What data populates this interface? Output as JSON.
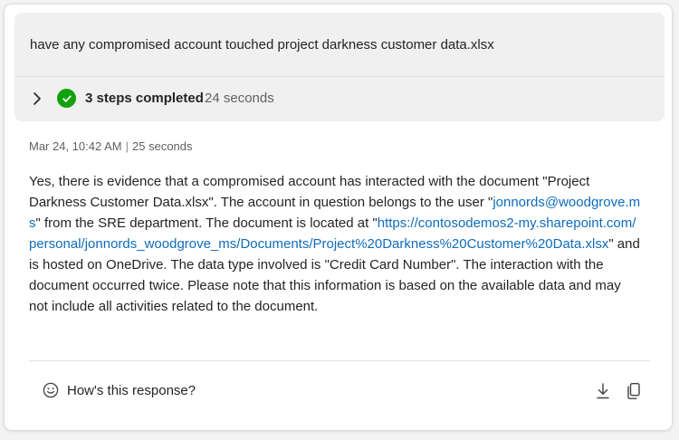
{
  "prompt": {
    "text": "have any compromised account touched project darkness customer data.xlsx"
  },
  "steps": {
    "label": "3 steps completed",
    "duration": "24 seconds",
    "status_color": "#13a10e"
  },
  "meta": {
    "timestamp": "Mar 24, 10:42 AM",
    "separator": "|",
    "elapsed": "25 seconds"
  },
  "response": {
    "part1": "Yes, there is evidence that a compromised account has interacted with the document \"Project Darkness Customer Data.xlsx\". The account in question belongs to the user \"",
    "email": "jonnords@woodgrove.ms",
    "part2": "\" from the SRE department. The document is located at \"",
    "url": "https://contosodemos2-my.sharepoint.com/personal/jonnords_woodgrove_ms/Documents/Project%20Darkness%20Customer%20Data.xlsx",
    "part3": "\" and is hosted on OneDrive. The data type involved is \"Credit Card Number\". The interaction with the document occurred twice. Please note that this information is based on the available data and may not include all activities related to the document.",
    "link_color": "#0f6cbd"
  },
  "footer": {
    "feedback_label": "How's this response?",
    "icons": [
      "smile-icon",
      "download-icon",
      "copy-icon"
    ]
  }
}
